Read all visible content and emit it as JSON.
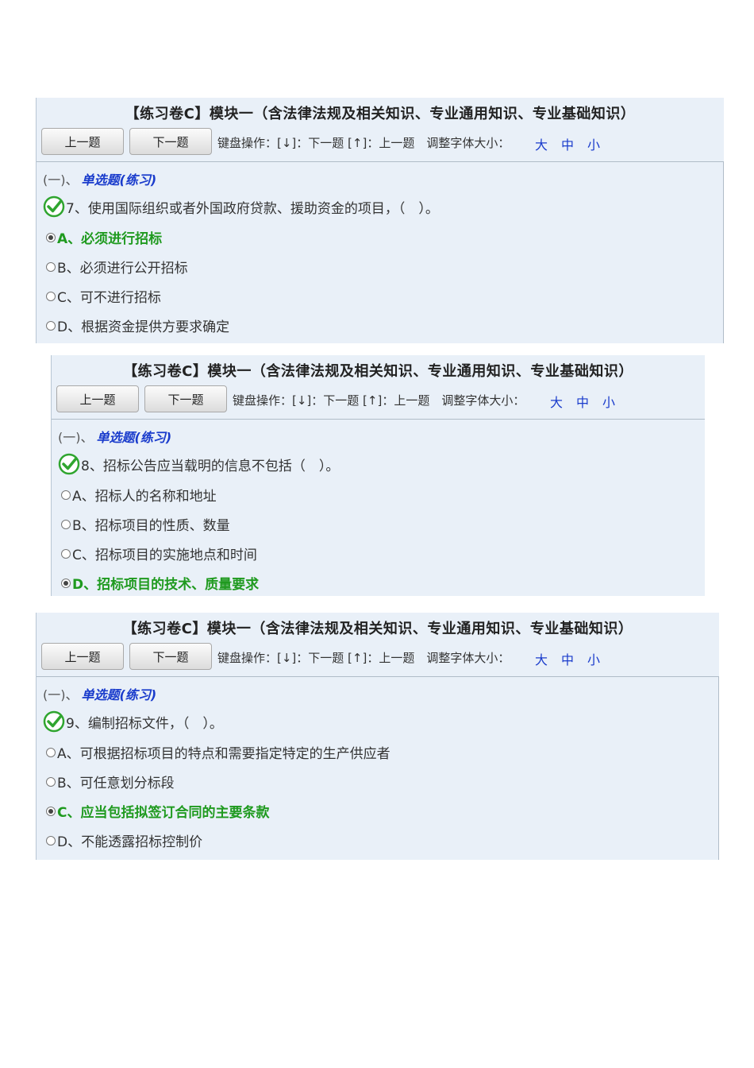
{
  "panels": [
    {
      "title": "【练习卷C】模块一（含法律法规及相关知识、专业通用知识、专业基础知识）",
      "prev_label": "上一题",
      "next_label": "下一题",
      "keyboard_hint": "键盘操作：[↓]：下一题 [↑]：上一题　调整字体大小：",
      "font_large": "大",
      "font_medium": "中",
      "font_small": "小",
      "section_index": "(一)、",
      "section_kind": "单选题(练习)",
      "question": "7、使用国际组织或者外国政府贷款、援助资金的项目，（　）。",
      "options": [
        {
          "text": "A、必须进行招标",
          "selected": true,
          "correct": true
        },
        {
          "text": "B、必须进行公开招标",
          "selected": false,
          "correct": false
        },
        {
          "text": "C、可不进行招标",
          "selected": false,
          "correct": false
        },
        {
          "text": "D、根据资金提供方要求确定",
          "selected": false,
          "correct": false
        }
      ]
    },
    {
      "title": "【练习卷C】模块一（含法律法规及相关知识、专业通用知识、专业基础知识）",
      "prev_label": "上一题",
      "next_label": "下一题",
      "keyboard_hint": "键盘操作：[↓]：下一题 [↑]：上一题　调整字体大小：",
      "font_large": "大",
      "font_medium": "中",
      "font_small": "小",
      "section_index": "(一)、",
      "section_kind": "单选题(练习)",
      "question": "8、招标公告应当载明的信息不包括（　）。",
      "options": [
        {
          "text": "A、招标人的名称和地址",
          "selected": false,
          "correct": false
        },
        {
          "text": "B、招标项目的性质、数量",
          "selected": false,
          "correct": false
        },
        {
          "text": "C、招标项目的实施地点和时间",
          "selected": false,
          "correct": false
        },
        {
          "text": "D、招标项目的技术、质量要求",
          "selected": true,
          "correct": true
        }
      ]
    },
    {
      "title": "【练习卷C】模块一（含法律法规及相关知识、专业通用知识、专业基础知识）",
      "prev_label": "上一题",
      "next_label": "下一题",
      "keyboard_hint": "键盘操作：[↓]：下一题 [↑]：上一题　调整字体大小：",
      "font_large": "大",
      "font_medium": "中",
      "font_small": "小",
      "section_index": "(一)、",
      "section_kind": "单选题(练习)",
      "question": "9、编制招标文件，（　）。",
      "options": [
        {
          "text": "A、可根据招标项目的特点和需要指定特定的生产供应者",
          "selected": false,
          "correct": false
        },
        {
          "text": "B、可任意划分标段",
          "selected": false,
          "correct": false
        },
        {
          "text": "C、应当包括拟签订合同的主要条款",
          "selected": true,
          "correct": true
        },
        {
          "text": "D、不能透露招标控制价",
          "selected": false,
          "correct": false
        }
      ]
    }
  ],
  "colors": {
    "panel_bg": "#e9f0f8",
    "correct": "#1f9a1f",
    "link": "#1a3ccc",
    "check": "#2fa52f"
  },
  "icons": {
    "answered_check": "check-circle-icon",
    "radio": "radio-button"
  }
}
